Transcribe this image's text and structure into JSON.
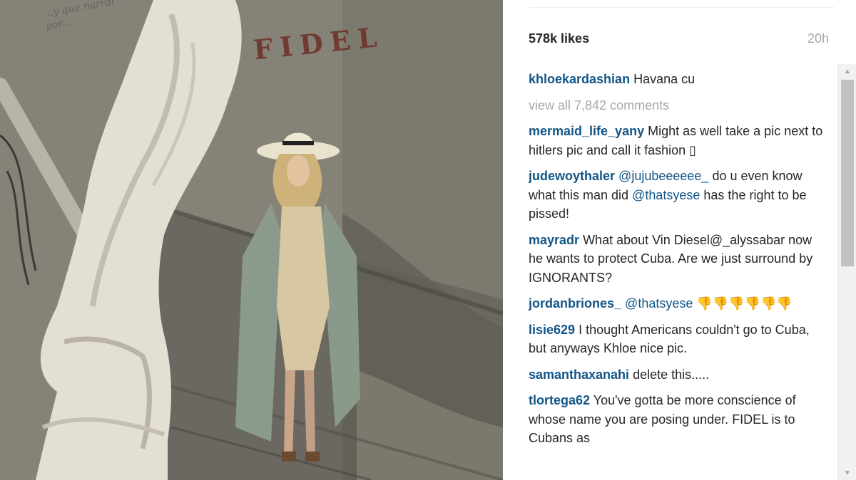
{
  "photo": {
    "wall_sign": "FIDEL",
    "graffiti": "...y que narrar por..."
  },
  "post": {
    "likes": "578k likes",
    "time_ago": "20h",
    "caption": {
      "user": "khloekardashian",
      "text": "Havana cu"
    },
    "view_all": "view all 7,842 comments",
    "comments": [
      {
        "user": "mermaid_life_yany",
        "text": "Might as well take a pic next to hitlers pic and call it fashion ▯"
      },
      {
        "user": "judewoythaler",
        "mention": "@jujubeeeeee_",
        "text": " do u even know what this man did ",
        "mention2": "@thatsyese",
        "text2": " has the right to be pissed!"
      },
      {
        "user": "mayradr",
        "text": "What about Vin Diesel@_alyssabar now he wants to protect Cuba. Are we just surround by IGNORANTS?"
      },
      {
        "user": "jordanbriones_",
        "mention": "@thatsyese",
        "text": " 👎👎👎👎👎👎"
      },
      {
        "user": "lisie629",
        "text": "I thought Americans couldn't go to Cuba, but anyways Khloe nice pic."
      },
      {
        "user": "samanthaxanahi",
        "text": "delete this....."
      },
      {
        "user": "tlortega62",
        "text": "You've gotta be more conscience of whose name you are posing under. FIDEL is to Cubans as"
      }
    ]
  },
  "icons": {
    "scroll_up": "▲",
    "scroll_down": "▼"
  }
}
